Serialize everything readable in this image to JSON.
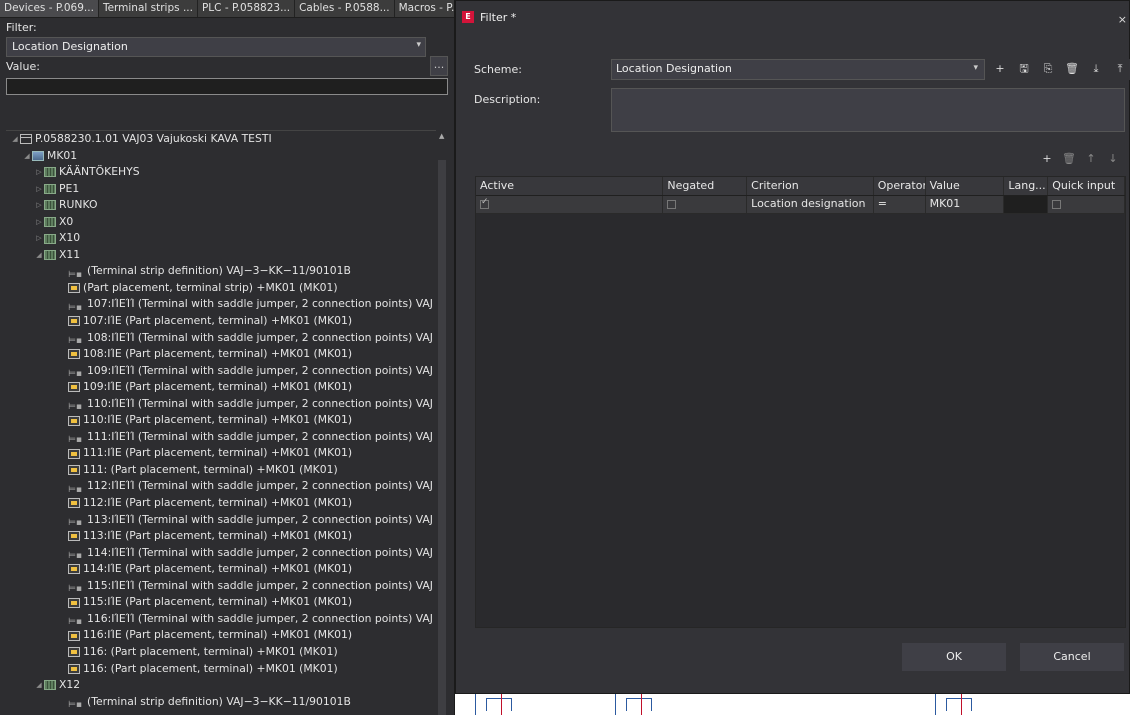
{
  "left_panel": {
    "tabs": [
      "Devices - P.069...",
      "Terminal strips ...",
      "PLC - P.058823...",
      "Cables - P.0588...",
      "Macros - P.058..."
    ],
    "filter_label": "Filter:",
    "filter_value": "Location Designation",
    "more_button": "...",
    "value_label": "Value:",
    "value_input": "",
    "tree": [
      {
        "indent": 0,
        "twisty": "◢",
        "icon": "proj",
        "text": "P.0588230.1.01 VAJ03 Vajukoski KAVA TESTI"
      },
      {
        "indent": 1,
        "twisty": "◢",
        "icon": "loc",
        "text": "MK01"
      },
      {
        "indent": 2,
        "twisty": "▷",
        "icon": "loc2",
        "text": "KÄÄNTÖKEHYS"
      },
      {
        "indent": 2,
        "twisty": "▷",
        "icon": "loc2",
        "text": "PE1"
      },
      {
        "indent": 2,
        "twisty": "▷",
        "icon": "loc2",
        "text": "RUNKO"
      },
      {
        "indent": 2,
        "twisty": "▷",
        "icon": "loc2",
        "text": "X0"
      },
      {
        "indent": 2,
        "twisty": "▷",
        "icon": "loc2",
        "text": "X10"
      },
      {
        "indent": 2,
        "twisty": "◢",
        "icon": "loc2",
        "text": "X11"
      },
      {
        "indent": 4,
        "twisty": "",
        "icon": "strip",
        "text": "(Terminal strip definition) VAJ−3−KK−11/90101B"
      },
      {
        "indent": 4,
        "twisty": "",
        "icon": "part",
        "text": "(Part placement, terminal strip) +MK01 (MK01)"
      },
      {
        "indent": 4,
        "twisty": "",
        "icon": "strip",
        "text": "107:ΙΊΕΊΊ (Terminal with saddle jumper, 2 connection points) VAJ"
      },
      {
        "indent": 4,
        "twisty": "",
        "icon": "part",
        "text": "107:ΙΊΕ (Part placement, terminal) +MK01 (MK01)"
      },
      {
        "indent": 4,
        "twisty": "",
        "icon": "strip",
        "text": "108:ΙΊΕΊΊ (Terminal with saddle jumper, 2 connection points) VAJ"
      },
      {
        "indent": 4,
        "twisty": "",
        "icon": "part",
        "text": "108:ΙΊΕ (Part placement, terminal) +MK01 (MK01)"
      },
      {
        "indent": 4,
        "twisty": "",
        "icon": "strip",
        "text": "109:ΙΊΕΊΊ (Terminal with saddle jumper, 2 connection points) VAJ"
      },
      {
        "indent": 4,
        "twisty": "",
        "icon": "part",
        "text": "109:ΙΊΕ (Part placement, terminal) +MK01 (MK01)"
      },
      {
        "indent": 4,
        "twisty": "",
        "icon": "strip",
        "text": "110:ΙΊΕΊΊ (Terminal with saddle jumper, 2 connection points) VAJ"
      },
      {
        "indent": 4,
        "twisty": "",
        "icon": "part",
        "text": "110:ΙΊΕ (Part placement, terminal) +MK01 (MK01)"
      },
      {
        "indent": 4,
        "twisty": "",
        "icon": "strip",
        "text": "111:ΙΊΕΊΊ (Terminal with saddle jumper, 2 connection points) VAJ"
      },
      {
        "indent": 4,
        "twisty": "",
        "icon": "part",
        "text": "111:ΙΊΕ (Part placement, terminal) +MK01 (MK01)"
      },
      {
        "indent": 4,
        "twisty": "",
        "icon": "part",
        "text": "111: (Part placement, terminal) +MK01 (MK01)"
      },
      {
        "indent": 4,
        "twisty": "",
        "icon": "strip",
        "text": "112:ΙΊΕΊΊ (Terminal with saddle jumper, 2 connection points) VAJ"
      },
      {
        "indent": 4,
        "twisty": "",
        "icon": "part",
        "text": "112:ΙΊΕ (Part placement, terminal) +MK01 (MK01)"
      },
      {
        "indent": 4,
        "twisty": "",
        "icon": "strip",
        "text": "113:ΙΊΕΊΊ (Terminal with saddle jumper, 2 connection points) VAJ"
      },
      {
        "indent": 4,
        "twisty": "",
        "icon": "part",
        "text": "113:ΙΊΕ (Part placement, terminal) +MK01 (MK01)"
      },
      {
        "indent": 4,
        "twisty": "",
        "icon": "strip",
        "text": "114:ΙΊΕΊΊ (Terminal with saddle jumper, 2 connection points) VAJ"
      },
      {
        "indent": 4,
        "twisty": "",
        "icon": "part",
        "text": "114:ΙΊΕ (Part placement, terminal) +MK01 (MK01)"
      },
      {
        "indent": 4,
        "twisty": "",
        "icon": "strip",
        "text": "115:ΙΊΕΊΊ (Terminal with saddle jumper, 2 connection points) VAJ"
      },
      {
        "indent": 4,
        "twisty": "",
        "icon": "part",
        "text": "115:ΙΊΕ (Part placement, terminal) +MK01 (MK01)"
      },
      {
        "indent": 4,
        "twisty": "",
        "icon": "strip",
        "text": "116:ΙΊΕΊΊ (Terminal with saddle jumper, 2 connection points) VAJ"
      },
      {
        "indent": 4,
        "twisty": "",
        "icon": "part",
        "text": "116:ΙΊΕ (Part placement, terminal) +MK01 (MK01)"
      },
      {
        "indent": 4,
        "twisty": "",
        "icon": "part",
        "text": "116: (Part placement, terminal) +MK01 (MK01)"
      },
      {
        "indent": 4,
        "twisty": "",
        "icon": "part",
        "text": "116: (Part placement, terminal) +MK01 (MK01)"
      },
      {
        "indent": 2,
        "twisty": "◢",
        "icon": "loc2",
        "text": "X12"
      },
      {
        "indent": 4,
        "twisty": "",
        "icon": "strip",
        "text": "(Terminal strip definition) VAJ−3−KK−11/90101B"
      }
    ]
  },
  "dialog": {
    "title": "Filter *",
    "logo": "E",
    "close": "×",
    "scheme_label": "Scheme:",
    "scheme_value": "Location Designation",
    "description_label": "Description:",
    "description_value": "",
    "scheme_tools": [
      {
        "name": "new-icon",
        "glyph": "+"
      },
      {
        "name": "save-icon",
        "glyph": "🖫"
      },
      {
        "name": "save-as-icon",
        "glyph": "⎘"
      },
      {
        "name": "delete-icon",
        "glyph": "🗑"
      },
      {
        "name": "import-icon",
        "glyph": "⤓"
      },
      {
        "name": "export-icon",
        "glyph": "⤒"
      }
    ],
    "grid_tools": [
      {
        "name": "add-row-icon",
        "glyph": "+"
      },
      {
        "name": "delete-row-icon",
        "glyph": "🗑"
      },
      {
        "name": "move-up-icon",
        "glyph": "↑"
      },
      {
        "name": "move-down-icon",
        "glyph": "↓"
      }
    ],
    "columns": [
      "Active",
      "Negated",
      "Criterion",
      "Operator",
      "Value",
      "Lang...",
      "Quick input"
    ],
    "row": {
      "active": true,
      "negated": false,
      "criterion": "Location designation",
      "operator": "=",
      "value": "MK01",
      "lang": "",
      "quick_input": false
    },
    "ok": "OK",
    "cancel": "Cancel"
  },
  "colors": {
    "accent_logo": "#d3143a",
    "schematic_blue": "#2c5aa0",
    "schematic_red": "#c0102a"
  }
}
